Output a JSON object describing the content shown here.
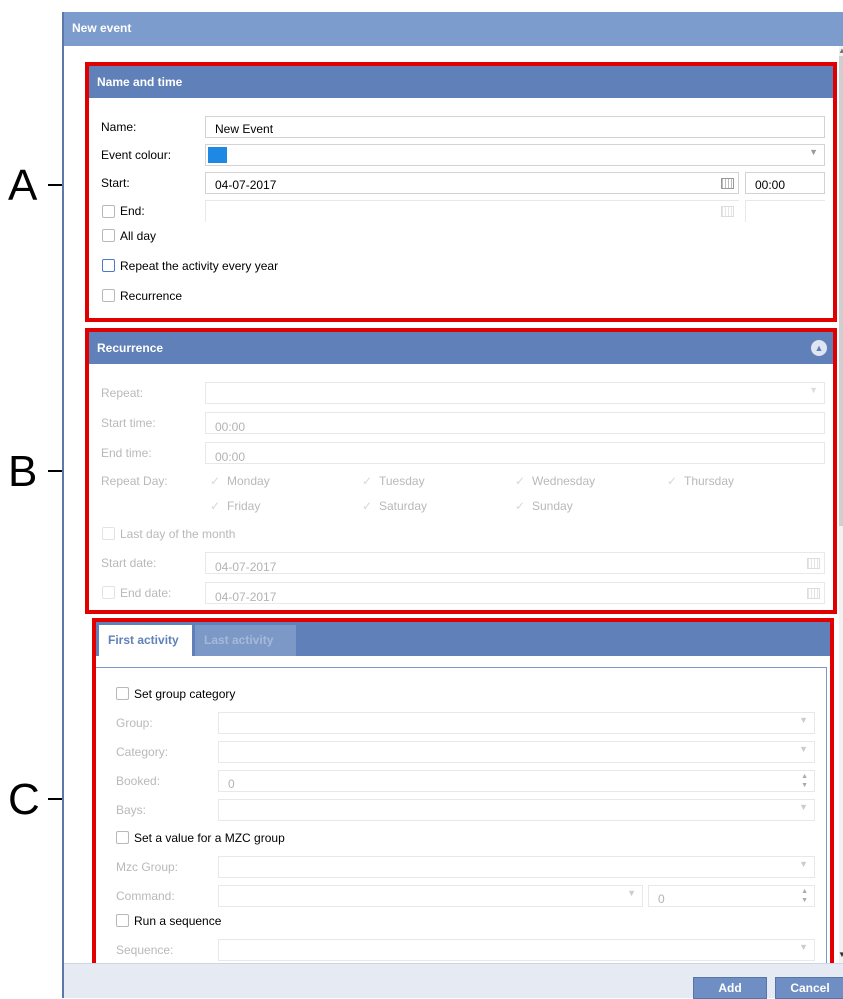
{
  "callouts": [
    "A",
    "B",
    "C"
  ],
  "dialog": {
    "title": "New event"
  },
  "name_time": {
    "header": "Name and time",
    "name_label": "Name:",
    "name_value": "New Event",
    "colour_label": "Event colour:",
    "colour_swatch": "#1e88e5",
    "start_label": "Start:",
    "start_date": "04-07-2017",
    "start_time": "00:00",
    "end_label": "End:",
    "allday_label": "All day",
    "repeat_year_label": "Repeat the activity every year",
    "recurrence_label": "Recurrence"
  },
  "recurrence": {
    "header": "Recurrence",
    "repeat_label": "Repeat:",
    "start_time_label": "Start time:",
    "start_time_value": "00:00",
    "end_time_label": "End time:",
    "end_time_value": "00:00",
    "repeat_day_label": "Repeat Day:",
    "days": [
      "Monday",
      "Tuesday",
      "Wednesday",
      "Thursday",
      "Friday",
      "Saturday",
      "Sunday"
    ],
    "last_day_label": "Last day of the month",
    "start_date_label": "Start date:",
    "start_date_value": "04-07-2017",
    "end_date_label": "End date:",
    "end_date_value": "04-07-2017"
  },
  "activity": {
    "tabs": [
      "First activity",
      "Last activity"
    ],
    "set_group_label": "Set group category",
    "group_label": "Group:",
    "category_label": "Category:",
    "booked_label": "Booked:",
    "booked_value": "0",
    "bays_label": "Bays:",
    "mzc_label": "Set a value for a MZC group",
    "mzc_group_label": "Mzc Group:",
    "command_label": "Command:",
    "command_value": "0",
    "sequence_check_label": "Run a sequence",
    "sequence_label": "Sequence:"
  },
  "footer": {
    "add": "Add",
    "cancel": "Cancel"
  }
}
